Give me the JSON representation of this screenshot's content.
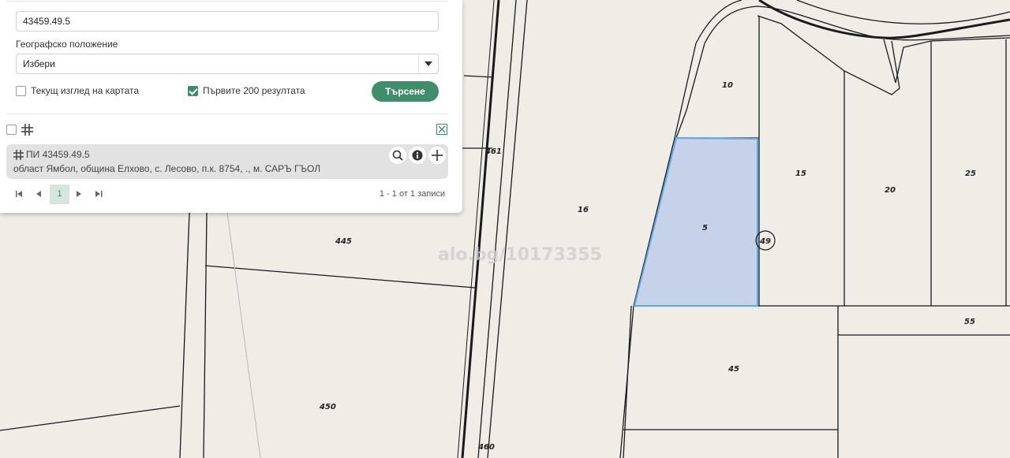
{
  "search": {
    "query_value": "43459.49.5",
    "geo_label": "Географско положение",
    "geo_select_value": "Избери",
    "current_view_label": "Текущ изглед на картата",
    "current_view_checked": false,
    "first200_label": "Първите 200 резултата",
    "first200_checked": true,
    "search_button": "Търсене"
  },
  "result": {
    "title": "ПИ 43459.49.5",
    "address": "област Ямбол, община Елхово, с. Лесово, п.к. 8754, ., м. САРЪ ГЪОЛ"
  },
  "pagination": {
    "current_page": "1",
    "summary": "1 - 1 от 1 записи"
  },
  "map": {
    "watermark": "alo.bg/10173355",
    "parcel_labels": {
      "p461": "461",
      "p445": "445",
      "p450": "450",
      "p460": "460",
      "p16": "16",
      "p10": "10",
      "p5": "5",
      "p15": "15",
      "p20": "20",
      "p25": "25",
      "p55": "55",
      "p45": "45",
      "p49": "49"
    },
    "highlight_fill": "#c5d2ea",
    "highlight_stroke": "#5fa7e0"
  }
}
